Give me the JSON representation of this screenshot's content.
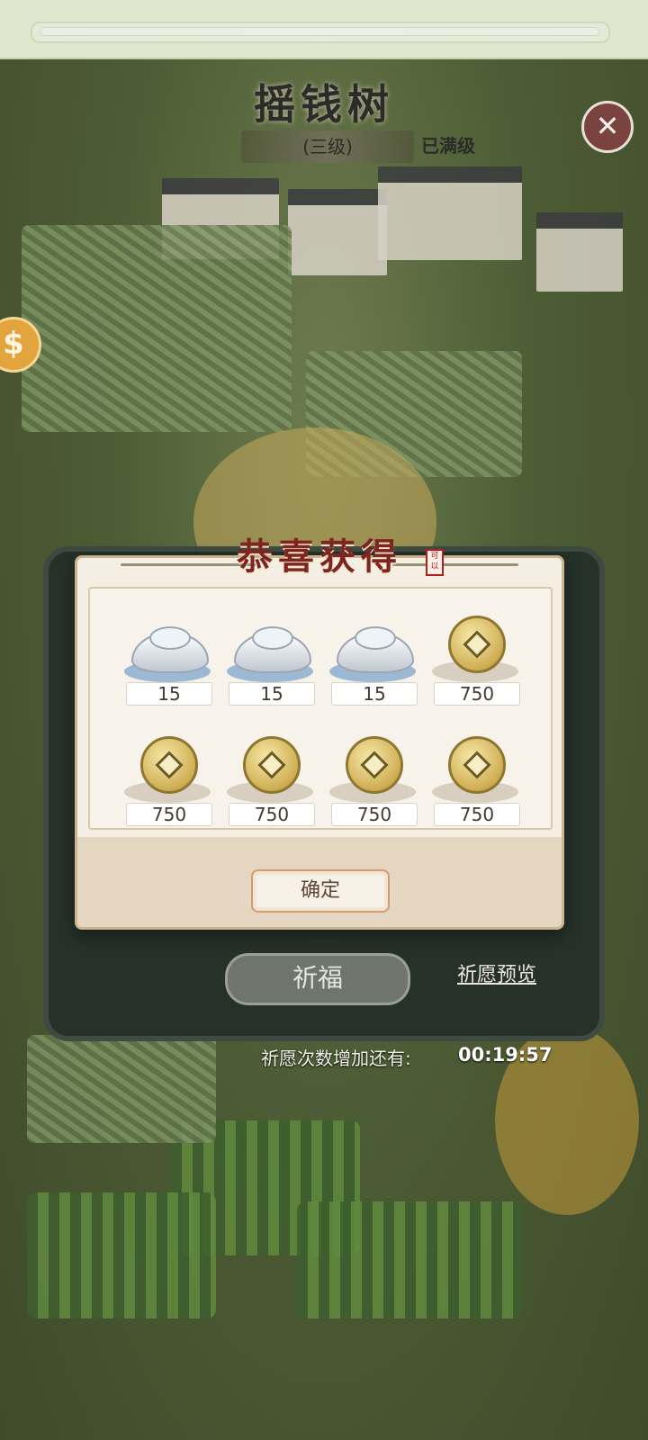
{
  "header": {
    "title": "摇钱树",
    "level": "(三级)",
    "maxed_label": "已满级",
    "close_symbol": "✕"
  },
  "modal": {
    "title": "恭喜获得",
    "seal_text": "可以",
    "rewards": [
      {
        "type": "silver-ingot",
        "amount": "15"
      },
      {
        "type": "silver-ingot",
        "amount": "15"
      },
      {
        "type": "silver-ingot",
        "amount": "15"
      },
      {
        "type": "copper-coin",
        "amount": "750"
      },
      {
        "type": "copper-coin",
        "amount": "750"
      },
      {
        "type": "copper-coin",
        "amount": "750"
      },
      {
        "type": "copper-coin",
        "amount": "750"
      },
      {
        "type": "copper-coin",
        "amount": "750"
      }
    ],
    "confirm_label": "确定"
  },
  "actions": {
    "pray_label": "祈福",
    "preview_label": "祈愿预览"
  },
  "timer": {
    "label": "祈愿次数增加还有:",
    "value": "00:19:57"
  },
  "colors": {
    "title_red": "#7f2520",
    "board": "#25302a",
    "modal_bg": "#efe6d6"
  }
}
